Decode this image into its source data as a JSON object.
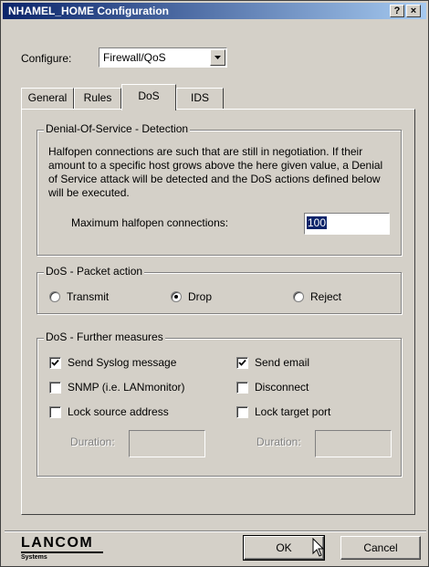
{
  "window": {
    "title": "NHAMEL_HOME Configuration",
    "help_button": "?",
    "close_button": "×"
  },
  "configure": {
    "label": "Configure:",
    "value": "Firewall/QoS"
  },
  "tabs": [
    {
      "label": "General",
      "active": false
    },
    {
      "label": "Rules",
      "active": false
    },
    {
      "label": "DoS",
      "active": true
    },
    {
      "label": "IDS",
      "active": false
    }
  ],
  "detection": {
    "title": "Denial-Of-Service - Detection",
    "description": "Halfopen connections are such that are still in negotiation. If their amount to a specific host grows above the here given value, a Denial of Service attack will be detected and the DoS actions defined below will be executed.",
    "max_label": "Maximum halfopen connections:",
    "max_value": "100"
  },
  "packet_action": {
    "title": "DoS - Packet action",
    "options": [
      {
        "label": "Transmit",
        "selected": false
      },
      {
        "label": "Drop",
        "selected": true
      },
      {
        "label": "Reject",
        "selected": false
      }
    ]
  },
  "further": {
    "title": "DoS - Further measures",
    "send_syslog": {
      "label": "Send Syslog message",
      "checked": true
    },
    "send_email": {
      "label": "Send email",
      "checked": true
    },
    "snmp": {
      "label": "SNMP (i.e. LANmonitor)",
      "checked": false
    },
    "disconnect": {
      "label": "Disconnect",
      "checked": false
    },
    "lock_source": {
      "label": "Lock source address",
      "checked": false
    },
    "lock_target": {
      "label": "Lock target port",
      "checked": false
    },
    "duration_label": "Duration:"
  },
  "logo": {
    "text": "LANCOM",
    "sub": "Systems"
  },
  "buttons": {
    "ok": "OK",
    "cancel": "Cancel"
  },
  "colors": {
    "title_start": "#0a246a",
    "title_end": "#a6caf0",
    "face": "#d4d0c8"
  }
}
